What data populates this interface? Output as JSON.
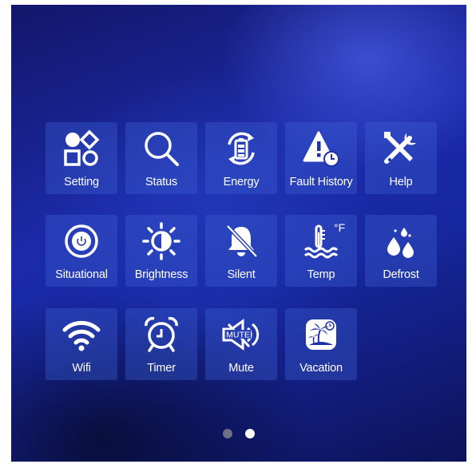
{
  "apps": [
    {
      "label": "Setting",
      "icon": "setting-icon"
    },
    {
      "label": "Status",
      "icon": "status-magnifier-icon"
    },
    {
      "label": "Energy",
      "icon": "energy-battery-icon"
    },
    {
      "label": "Fault History",
      "icon": "fault-warning-icon"
    },
    {
      "label": "Help",
      "icon": "help-tools-icon"
    },
    {
      "label": "Situational",
      "icon": "situational-power-icon"
    },
    {
      "label": "Brightness",
      "icon": "brightness-sun-icon"
    },
    {
      "label": "Silent",
      "icon": "silent-bell-icon"
    },
    {
      "label": "Temp",
      "icon": "temp-thermometer-icon",
      "unit": "°F"
    },
    {
      "label": "Defrost",
      "icon": "defrost-drops-icon"
    },
    {
      "label": "Wifi",
      "icon": "wifi-icon"
    },
    {
      "label": "Timer",
      "icon": "timer-alarm-clock-icon"
    },
    {
      "label": "Mute",
      "icon": "mute-speaker-icon",
      "badge": "MUTE"
    },
    {
      "label": "Vacation",
      "icon": "vacation-island-icon"
    }
  ],
  "pagination": {
    "pages": 2,
    "current": 2
  },
  "colors": {
    "background": "#1727a0",
    "tile": "#3c5fd2",
    "text": "#ffffff"
  }
}
